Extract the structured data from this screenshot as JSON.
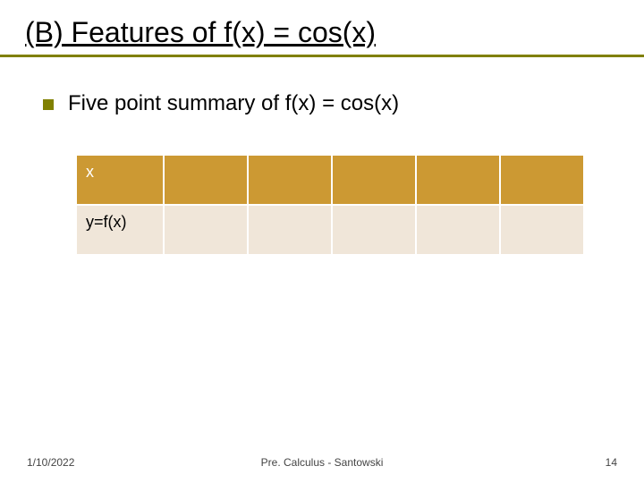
{
  "title": "(B) Features of f(x) = cos(x)",
  "bullet": "Five point summary of f(x) = cos(x)",
  "table": {
    "row1": {
      "label": "x",
      "c1": "",
      "c2": "",
      "c3": "",
      "c4": "",
      "c5": ""
    },
    "row2": {
      "label": "y=f(x)",
      "c1": "",
      "c2": "",
      "c3": "",
      "c4": "",
      "c5": ""
    }
  },
  "footer": {
    "date": "1/10/2022",
    "center": "Pre. Calculus - Santowski",
    "page": "14"
  }
}
